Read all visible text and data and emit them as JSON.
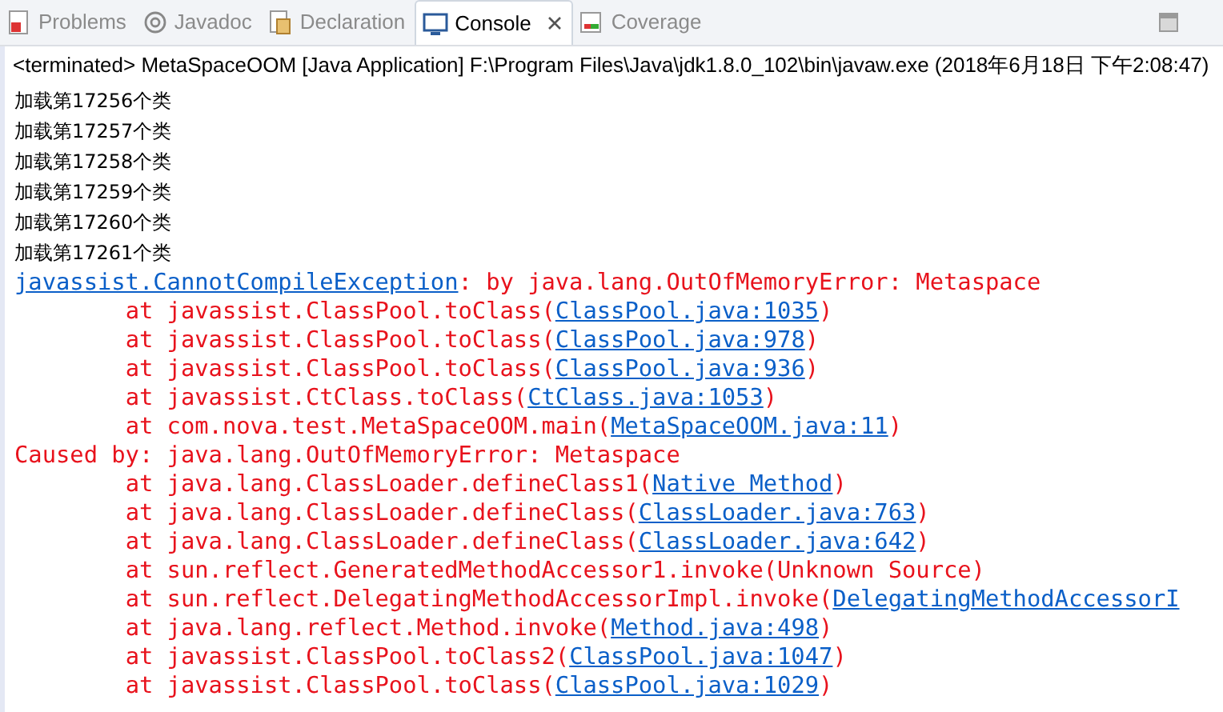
{
  "tabs": [
    {
      "label": "Problems",
      "selected": false,
      "closable": false
    },
    {
      "label": "Javadoc",
      "selected": false,
      "closable": false
    },
    {
      "label": "Declaration",
      "selected": false,
      "closable": false
    },
    {
      "label": "Console",
      "selected": true,
      "closable": true
    },
    {
      "label": "Coverage",
      "selected": false,
      "closable": false
    }
  ],
  "console": {
    "header": "<terminated> MetaSpaceOOM [Java Application] F:\\Program Files\\Java\\jdk1.8.0_102\\bin\\javaw.exe (2018年6月18日 下午2:08:47)",
    "lines": [
      {
        "kind": "out",
        "parts": [
          {
            "text": "加载第17256个类"
          }
        ]
      },
      {
        "kind": "out",
        "parts": [
          {
            "text": "加载第17257个类"
          }
        ]
      },
      {
        "kind": "out",
        "parts": [
          {
            "text": "加载第17258个类"
          }
        ]
      },
      {
        "kind": "out",
        "parts": [
          {
            "text": "加载第17259个类"
          }
        ]
      },
      {
        "kind": "out",
        "parts": [
          {
            "text": "加载第17260个类"
          }
        ]
      },
      {
        "kind": "out",
        "parts": [
          {
            "text": "加载第17261个类"
          }
        ]
      },
      {
        "kind": "err",
        "parts": [
          {
            "text": "javassist.CannotCompileException",
            "link": true
          },
          {
            "text": ": by java.lang.OutOfMemoryError: Metaspace"
          }
        ]
      },
      {
        "kind": "err",
        "parts": [
          {
            "text": "\tat javassist.ClassPool.toClass("
          },
          {
            "text": "ClassPool.java:1035",
            "link": true
          },
          {
            "text": ")"
          }
        ]
      },
      {
        "kind": "err",
        "parts": [
          {
            "text": "\tat javassist.ClassPool.toClass("
          },
          {
            "text": "ClassPool.java:978",
            "link": true
          },
          {
            "text": ")"
          }
        ]
      },
      {
        "kind": "err",
        "parts": [
          {
            "text": "\tat javassist.ClassPool.toClass("
          },
          {
            "text": "ClassPool.java:936",
            "link": true
          },
          {
            "text": ")"
          }
        ]
      },
      {
        "kind": "err",
        "parts": [
          {
            "text": "\tat javassist.CtClass.toClass("
          },
          {
            "text": "CtClass.java:1053",
            "link": true
          },
          {
            "text": ")"
          }
        ]
      },
      {
        "kind": "err",
        "parts": [
          {
            "text": "\tat com.nova.test.MetaSpaceOOM.main("
          },
          {
            "text": "MetaSpaceOOM.java:11",
            "link": true
          },
          {
            "text": ")"
          }
        ]
      },
      {
        "kind": "err",
        "parts": [
          {
            "text": "Caused by: java.lang.OutOfMemoryError: Metaspace"
          }
        ]
      },
      {
        "kind": "err",
        "parts": [
          {
            "text": "\tat java.lang.ClassLoader.defineClass1("
          },
          {
            "text": "Native Method",
            "link": true
          },
          {
            "text": ")"
          }
        ]
      },
      {
        "kind": "err",
        "parts": [
          {
            "text": "\tat java.lang.ClassLoader.defineClass("
          },
          {
            "text": "ClassLoader.java:763",
            "link": true
          },
          {
            "text": ")"
          }
        ]
      },
      {
        "kind": "err",
        "parts": [
          {
            "text": "\tat java.lang.ClassLoader.defineClass("
          },
          {
            "text": "ClassLoader.java:642",
            "link": true
          },
          {
            "text": ")"
          }
        ]
      },
      {
        "kind": "err",
        "parts": [
          {
            "text": "\tat sun.reflect.GeneratedMethodAccessor1.invoke(Unknown Source)"
          }
        ]
      },
      {
        "kind": "err",
        "parts": [
          {
            "text": "\tat sun.reflect.DelegatingMethodAccessorImpl.invoke("
          },
          {
            "text": "DelegatingMethodAccessorI",
            "link": true
          }
        ]
      },
      {
        "kind": "err",
        "parts": [
          {
            "text": "\tat java.lang.reflect.Method.invoke("
          },
          {
            "text": "Method.java:498",
            "link": true
          },
          {
            "text": ")"
          }
        ]
      },
      {
        "kind": "err",
        "parts": [
          {
            "text": "\tat javassist.ClassPool.toClass2("
          },
          {
            "text": "ClassPool.java:1047",
            "link": true
          },
          {
            "text": ")"
          }
        ]
      },
      {
        "kind": "err",
        "parts": [
          {
            "text": "\tat javassist.ClassPool.toClass("
          },
          {
            "text": "ClassPool.java:1029",
            "link": true
          },
          {
            "text": ")"
          }
        ]
      }
    ]
  }
}
